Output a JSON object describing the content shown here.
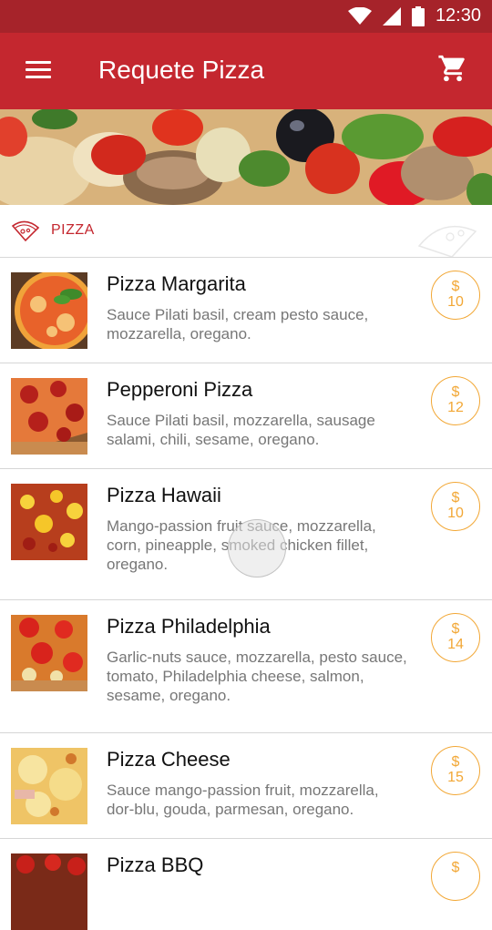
{
  "status": {
    "time": "12:30"
  },
  "appbar": {
    "title": "Requete Pizza"
  },
  "category": {
    "label": "PIZZA"
  },
  "items": [
    {
      "name": "Pizza Margarita",
      "description": "Sauce Pilati basil, cream pesto sauce, mozzarella, oregano.",
      "currency": "$",
      "price": "10"
    },
    {
      "name": "Pepperoni Pizza",
      "description": "Sauce Pilati basil, mozzarella, sausage salami, chili, sesame, oregano.",
      "currency": "$",
      "price": "12"
    },
    {
      "name": "Pizza Hawaii",
      "description": "Mango-passion fruit sauce, mozzarella, corn, pineapple, smoked chicken fillet, oregano.",
      "currency": "$",
      "price": "10"
    },
    {
      "name": "Pizza Philadelphia",
      "description": "Garlic-nuts sauce, mozzarella, pesto sauce, tomato, Philadelphia cheese, salmon, sesame, oregano.",
      "currency": "$",
      "price": "14"
    },
    {
      "name": "Pizza Cheese",
      "description": "Sauce mango-passion fruit, mozzarella, dor-blu, gouda, parmesan, oregano.",
      "currency": "$",
      "price": "15"
    },
    {
      "name": "Pizza BBQ",
      "description": "",
      "currency": "$",
      "price": ""
    }
  ],
  "colors": {
    "primary": "#c4272f",
    "status_bar": "#a6232a",
    "accent": "#f2a735",
    "divider": "#d6d6d6"
  },
  "icons": {
    "menu": "hamburger-icon",
    "cart": "cart-icon",
    "category": "pizza-slice-icon"
  }
}
